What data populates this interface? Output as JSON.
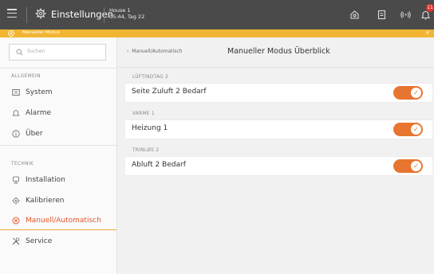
{
  "header": {
    "app_title": "Einstellungen",
    "house_name": "House 1",
    "house_status": "05:44, Tag 22",
    "notification_count": "11"
  },
  "mode_bar": {
    "label": "Manueller Modus"
  },
  "sidebar": {
    "search_placeholder": "Suchen",
    "section_general": "ALLGEMEIN",
    "section_technical": "TECHNIK",
    "items_general": [
      {
        "label": "System",
        "icon": "system-icon"
      },
      {
        "label": "Alarme",
        "icon": "bell-icon"
      },
      {
        "label": "Über",
        "icon": "info-icon"
      }
    ],
    "items_technical": [
      {
        "label": "Installation",
        "icon": "installation-icon"
      },
      {
        "label": "Kalibrieren",
        "icon": "calibrate-icon"
      },
      {
        "label": "Manuell/Automatisch",
        "icon": "manual-auto-icon",
        "active": true
      },
      {
        "label": "Service",
        "icon": "tools-icon"
      }
    ]
  },
  "main": {
    "breadcrumb": "Manuell/Automatisch",
    "title": "Manueller Modus Überblick",
    "groups": [
      {
        "label": "LÜFTINDTAG 2",
        "row_label": "Seite Zuluft 2 Bedarf",
        "toggle_on": true
      },
      {
        "label": "VARME 1",
        "row_label": "Heizung 1",
        "toggle_on": true
      },
      {
        "label": "TRINLØS 2",
        "row_label": "Abluft 2 Bedarf",
        "toggle_on": true
      }
    ]
  },
  "colors": {
    "topbar": "#4a4a4a",
    "mode_bar": "#f2b531",
    "accent": "#e8752f",
    "active_text": "#e8542b",
    "badge": "#e0342b"
  }
}
